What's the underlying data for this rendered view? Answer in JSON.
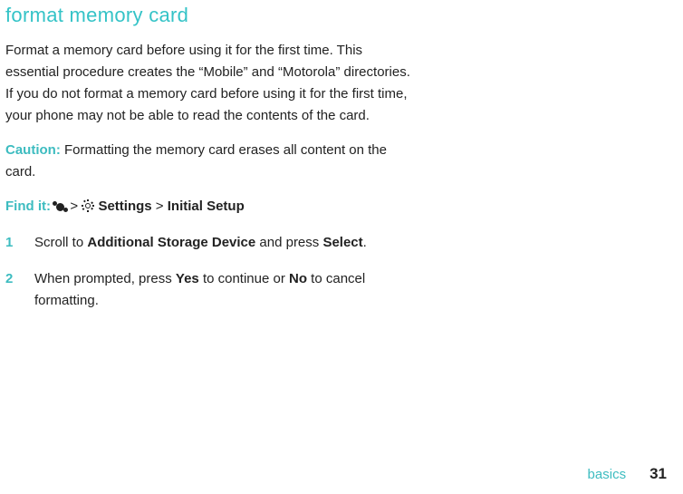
{
  "heading": "format memory card",
  "intro": "Format a memory card before using it for the first time. This essential procedure creates the “Mobile” and “Motorola” directories. If you do not format a memory card before using it for the first time, your phone may not be able to read the contents of the card.",
  "caution_label": "Caution:",
  "caution_text": " Formatting the memory card erases all content on the card.",
  "findit_label": "Find it: ",
  "findit_settings": "Settings",
  "findit_initial": "Initial Setup",
  "steps": [
    {
      "pre": "Scroll to ",
      "b1": "Additional Storage Device",
      "mid": " and press ",
      "b2": "Select",
      "post": "."
    },
    {
      "pre": "When prompted, press ",
      "b1": "Yes",
      "mid": " to continue or ",
      "b2": "No",
      "post": " to cancel formatting."
    }
  ],
  "footer_label": "basics",
  "footer_page": "31"
}
